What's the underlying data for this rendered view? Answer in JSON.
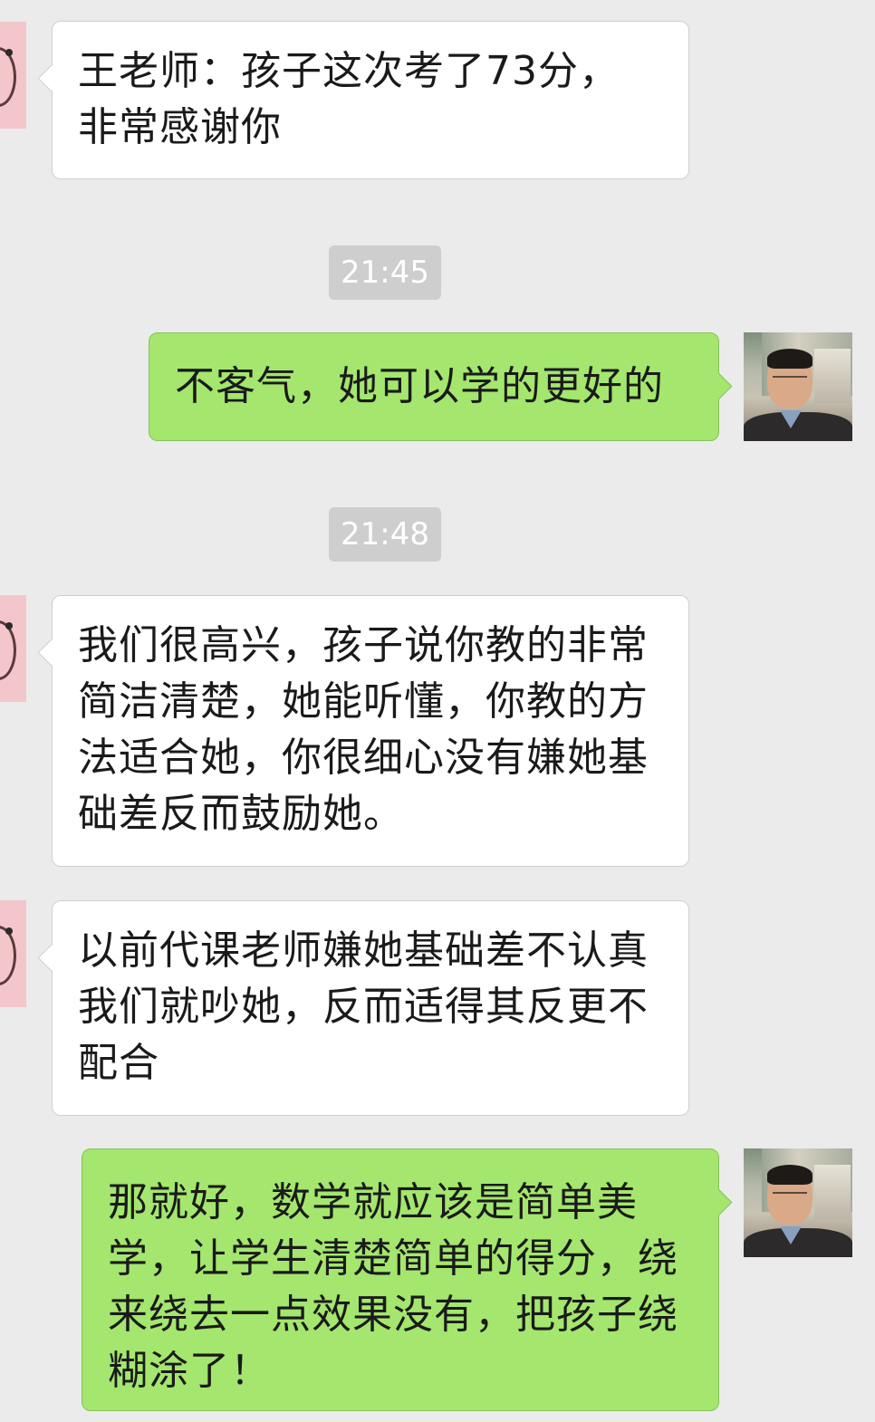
{
  "chat": {
    "messages": [
      {
        "type": "incoming",
        "text": "王老师：孩子这次考了73分，非常感谢你"
      },
      {
        "type": "timestamp",
        "text": "21:45"
      },
      {
        "type": "outgoing",
        "text": "不客气，她可以学的更好的"
      },
      {
        "type": "timestamp",
        "text": "21:48"
      },
      {
        "type": "incoming",
        "text": "我们很高兴，孩子说你教的非常简洁清楚，她能听懂，你教的方法适合她，你很细心没有嫌她基础差反而鼓励她。"
      },
      {
        "type": "incoming",
        "text": "以前代课老师嫌她基础差不认真我们就吵她，反而适得其反更不配合"
      },
      {
        "type": "outgoing",
        "text": "那就好，数学就应该是简单美学，让学生清楚简单的得分，绕来绕去一点效果没有，把孩子绕糊涂了！"
      }
    ]
  },
  "colors": {
    "background": "#ebebeb",
    "incoming_bubble": "#ffffff",
    "outgoing_bubble": "#a4e66e",
    "timestamp_pill": "#cecece"
  }
}
